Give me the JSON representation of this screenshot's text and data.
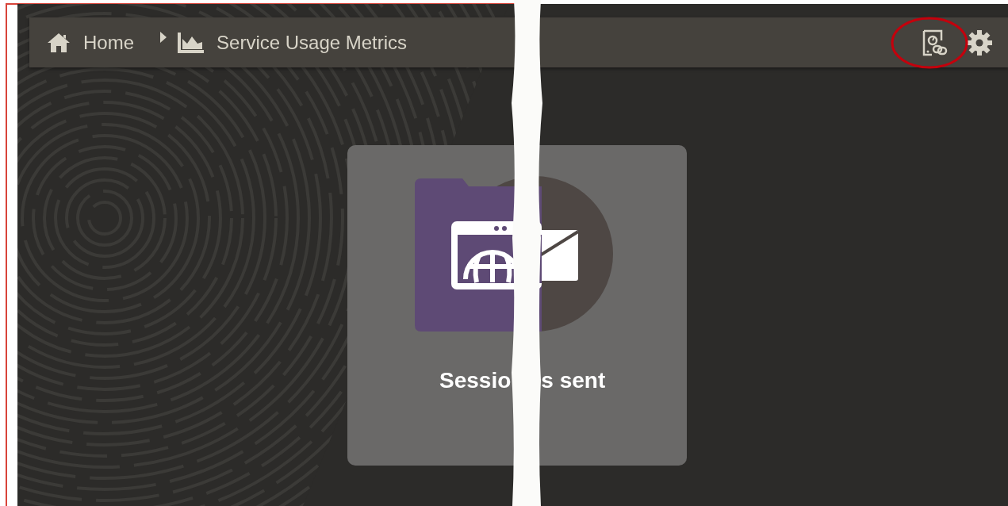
{
  "breadcrumb": [
    {
      "kind": "home",
      "label": "Home"
    },
    {
      "kind": "chart",
      "label": "Service Usage Metrics"
    }
  ],
  "tile": {
    "title_parts": [
      "Sessio",
      "s sent"
    ]
  }
}
